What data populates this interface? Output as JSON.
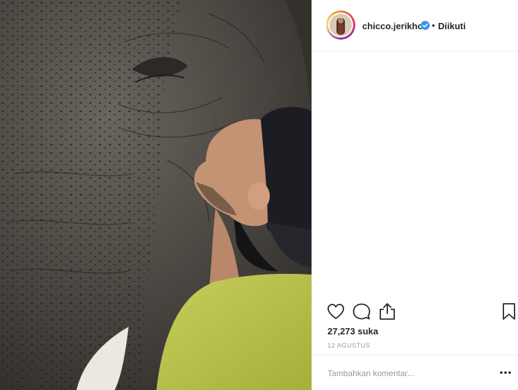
{
  "post": {
    "username": "chicco.jerikho",
    "follow_separator": "•",
    "follow_status": "Diikuti",
    "likes_text": "27,273 suka",
    "date_text": "12 AGUSTUS"
  },
  "comment": {
    "placeholder": "Tambahkan komentar..."
  },
  "icons": {
    "verified": "verified-badge-icon",
    "like": "heart-icon",
    "comment": "comment-bubble-icon",
    "share": "share-icon",
    "save": "bookmark-icon",
    "more": "more-options-icon"
  },
  "colors": {
    "verified_blue": "#3897f0",
    "text": "#262626",
    "muted": "#999999",
    "shirt": "#b9c24a"
  }
}
